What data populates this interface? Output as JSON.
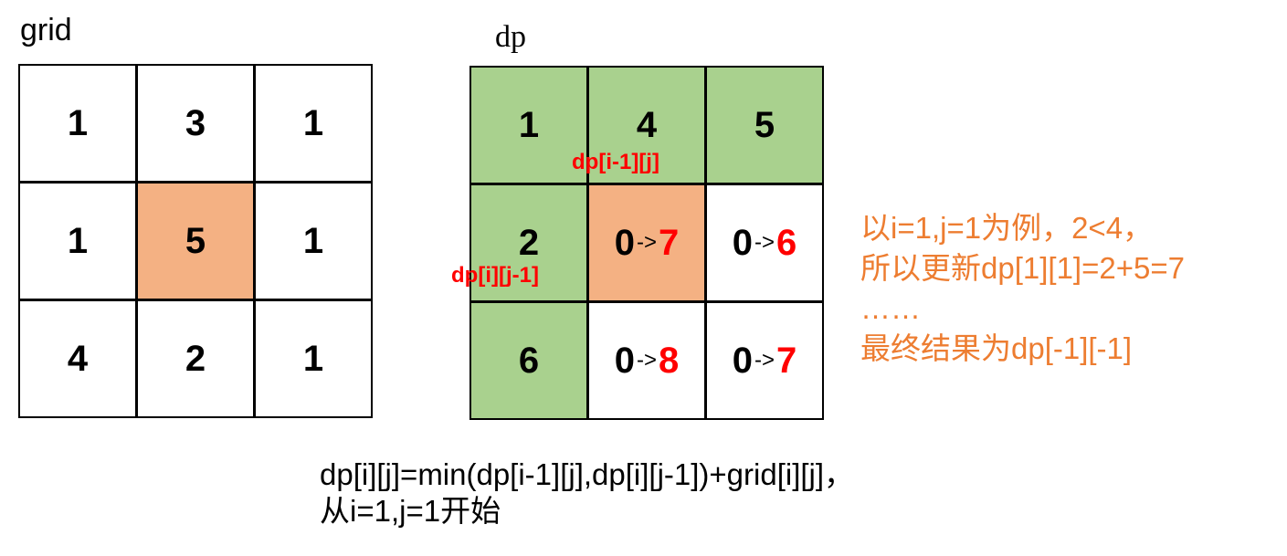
{
  "grid": {
    "title": "grid",
    "cells": [
      [
        "1",
        "3",
        "1"
      ],
      [
        "1",
        "5",
        "1"
      ],
      [
        "4",
        "2",
        "1"
      ]
    ]
  },
  "dp": {
    "title": "dp",
    "cells": [
      [
        {
          "v": "1"
        },
        {
          "v": "4"
        },
        {
          "v": "5"
        }
      ],
      [
        {
          "v": "2"
        },
        {
          "old": "0",
          "arrow": "->",
          "new": "7"
        },
        {
          "old": "0",
          "arrow": "->",
          "new": "6"
        }
      ],
      [
        {
          "v": "6"
        },
        {
          "old": "0",
          "arrow": "->",
          "new": "8"
        },
        {
          "old": "0",
          "arrow": "->",
          "new": "7"
        }
      ]
    ],
    "label_up": "dp[i-1][j]",
    "label_left": "dp[i][j-1]"
  },
  "note": {
    "line1": "以i=1,j=1为例，2<4，",
    "line2": "所以更新dp[1][1]=2+5=7",
    "line3": "……",
    "line4": "最终结果为dp[-1][-1]"
  },
  "formula": {
    "line1": "dp[i][j]=min(dp[i-1][j],dp[i][j-1])+grid[i][j]，",
    "line2": "从i=1,j=1开始"
  },
  "colors": {
    "highlight_orange": "#f4b183",
    "highlight_green": "#a9d18e",
    "red": "#ff0000",
    "note": "#ed7d31"
  }
}
